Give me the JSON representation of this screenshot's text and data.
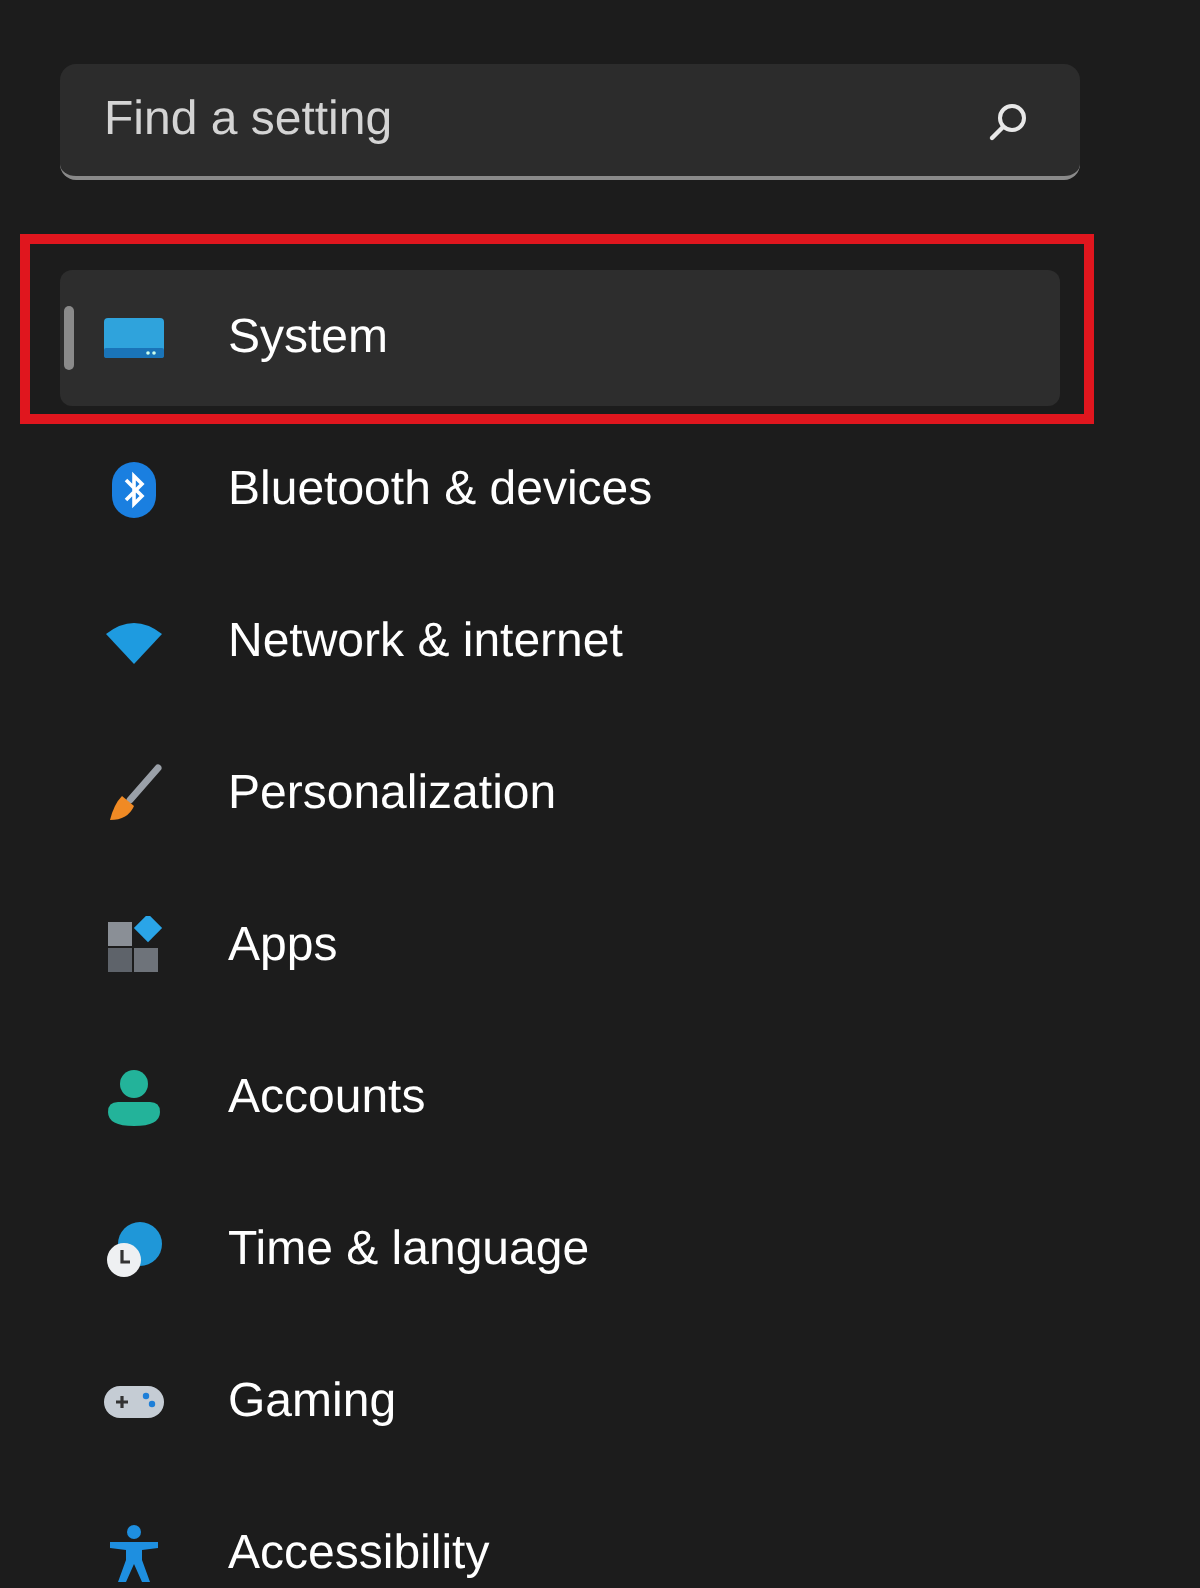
{
  "search": {
    "placeholder": "Find a setting"
  },
  "nav_items": [
    {
      "label": "System",
      "kind": "system",
      "selected": true,
      "highlighted": true
    },
    {
      "label": "Bluetooth & devices",
      "kind": "bluetooth",
      "selected": false,
      "highlighted": false
    },
    {
      "label": "Network & internet",
      "kind": "network",
      "selected": false,
      "highlighted": false
    },
    {
      "label": "Personalization",
      "kind": "personalization",
      "selected": false,
      "highlighted": false
    },
    {
      "label": "Apps",
      "kind": "apps",
      "selected": false,
      "highlighted": false
    },
    {
      "label": "Accounts",
      "kind": "accounts",
      "selected": false,
      "highlighted": false
    },
    {
      "label": "Time & language",
      "kind": "time",
      "selected": false,
      "highlighted": false
    },
    {
      "label": "Gaming",
      "kind": "gaming",
      "selected": false,
      "highlighted": false
    },
    {
      "label": "Accessibility",
      "kind": "accessibility",
      "selected": false,
      "highlighted": false
    }
  ]
}
